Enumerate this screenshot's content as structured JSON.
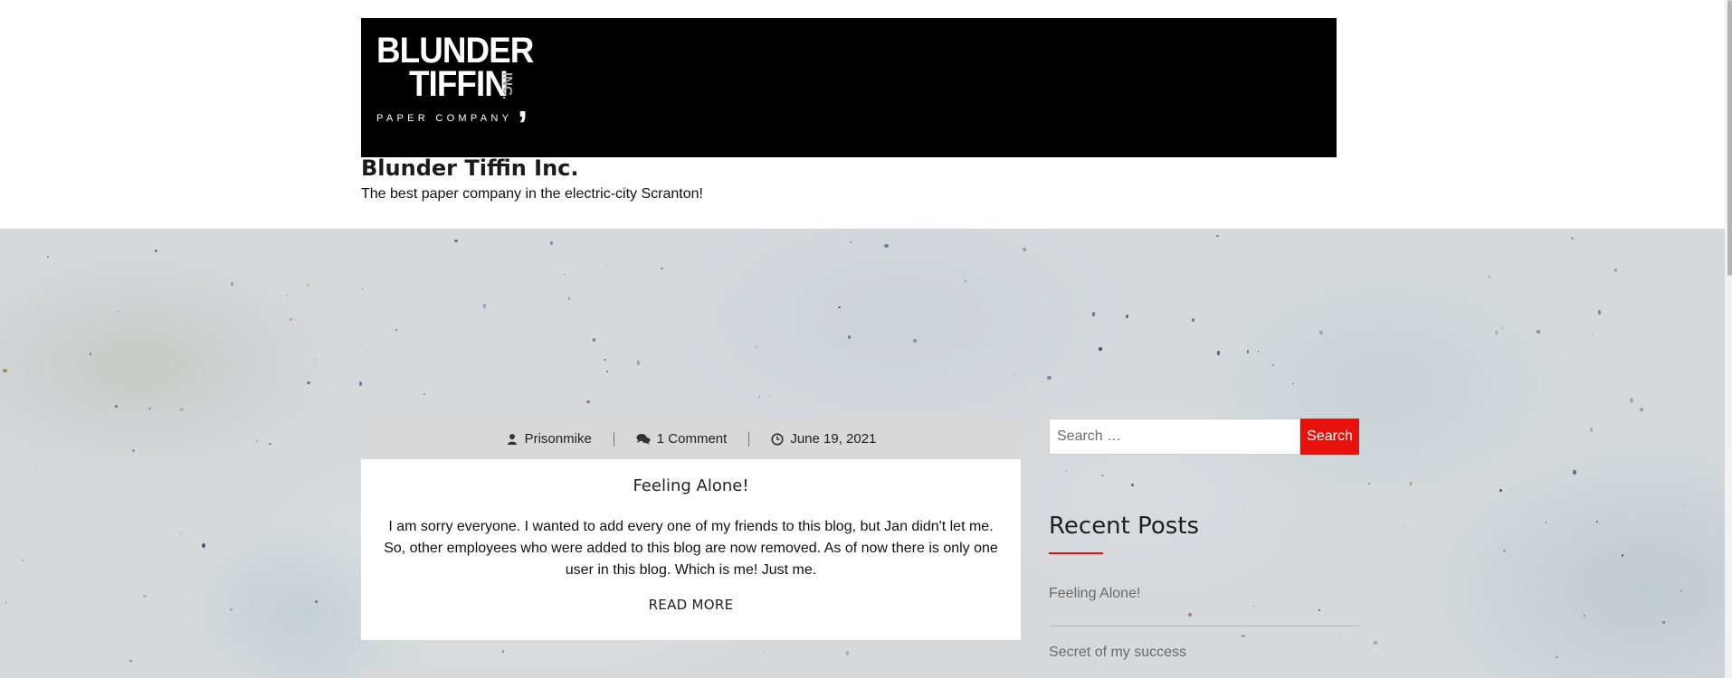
{
  "header": {
    "logo": {
      "line1": "BLUNDER",
      "line2": "TIFFIN",
      "inc": "INC.",
      "comma": ",",
      "tagline": "PAPER COMPANY"
    },
    "site_title": "Blunder Tiffin Inc.",
    "site_description": "The best paper company in the electric-city Scranton!"
  },
  "post": {
    "author": "Prisonmike",
    "comments": "1 Comment",
    "date": "June 19, 2021",
    "title": "Feeling Alone!",
    "excerpt": "I am sorry everyone. I wanted to add every one of my friends to this blog, but Jan didn't let me. So, other employees who were added to this blog are now removed. As of now there is only one user in this blog. Which is me! Just me.",
    "read_more": "READ MORE"
  },
  "sidebar": {
    "search": {
      "placeholder": "Search …",
      "button_label": "Search"
    },
    "recent_posts": {
      "title": "Recent Posts",
      "items": [
        {
          "label": "Feeling Alone!"
        },
        {
          "label": "Secret of my success"
        }
      ]
    }
  },
  "colors": {
    "accent": "#e8110b",
    "banner": "#000000",
    "meta_bar": "#d8d8d8"
  },
  "icons": {
    "author": "user-icon",
    "comments": "comments-icon",
    "date": "clock-icon"
  }
}
